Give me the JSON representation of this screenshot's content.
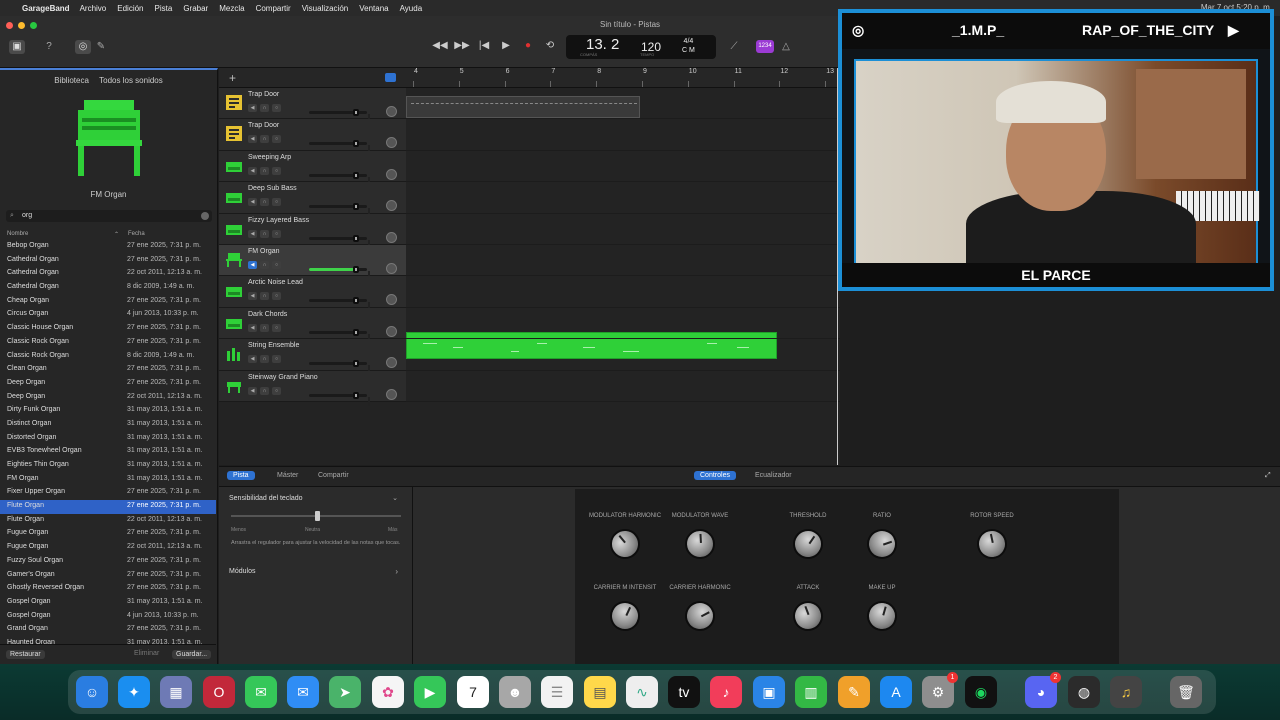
{
  "menubar": {
    "app": "GarageBand",
    "items": [
      "Archivo",
      "Edición",
      "Pista",
      "Grabar",
      "Mezcla",
      "Compartir",
      "Visualización",
      "Ventana",
      "Ayuda"
    ],
    "clock": "Mar 7 oct 5:20 p. m."
  },
  "window": {
    "title": "Sin título - Pistas"
  },
  "lcd": {
    "bar": "13. 2",
    "tempo": "120",
    "sig": "4/4",
    "key": "C M",
    "cap_bar": "COMPÁS",
    "cap_tempo": "TEMPO"
  },
  "count_in": "1234",
  "library": {
    "title": "Biblioteca",
    "filter": "Todos los sonidos",
    "instrument": "FM Organ",
    "search": "org",
    "col_name": "Nombre",
    "col_date": "Fecha",
    "restore": "Restaurar",
    "delete": "Eliminar",
    "save": "Guardar...",
    "rows": [
      {
        "name": "Bebop Organ",
        "date": "27 ene 2025, 7:31 p. m."
      },
      {
        "name": "Cathedral Organ",
        "date": "27 ene 2025, 7:31 p. m."
      },
      {
        "name": "Cathedral Organ",
        "date": "22 oct 2011, 12:13 a. m."
      },
      {
        "name": "Cathedral Organ",
        "date": "8 dic 2009, 1:49 a. m."
      },
      {
        "name": "Cheap Organ",
        "date": "27 ene 2025, 7:31 p. m."
      },
      {
        "name": "Circus Organ",
        "date": "4 jun 2013, 10:33 p. m."
      },
      {
        "name": "Classic House Organ",
        "date": "27 ene 2025, 7:31 p. m."
      },
      {
        "name": "Classic Rock Organ",
        "date": "27 ene 2025, 7:31 p. m."
      },
      {
        "name": "Classic Rock Organ",
        "date": "8 dic 2009, 1:49 a. m."
      },
      {
        "name": "Clean Organ",
        "date": "27 ene 2025, 7:31 p. m."
      },
      {
        "name": "Deep Organ",
        "date": "27 ene 2025, 7:31 p. m."
      },
      {
        "name": "Deep Organ",
        "date": "22 oct 2011, 12:13 a. m."
      },
      {
        "name": "Dirty Funk Organ",
        "date": "31 may 2013, 1:51 a. m."
      },
      {
        "name": "Distinct Organ",
        "date": "31 may 2013, 1:51 a. m."
      },
      {
        "name": "Distorted Organ",
        "date": "31 may 2013, 1:51 a. m."
      },
      {
        "name": "EVB3 Tonewheel Organ",
        "date": "31 may 2013, 1:51 a. m."
      },
      {
        "name": "Eighties Thin Organ",
        "date": "31 may 2013, 1:51 a. m."
      },
      {
        "name": "FM Organ",
        "date": "31 may 2013, 1:51 a. m."
      },
      {
        "name": "Fixer Upper Organ",
        "date": "27 ene 2025, 7:31 p. m."
      },
      {
        "name": "Flute Organ",
        "date": "27 ene 2025, 7:31 p. m."
      },
      {
        "name": "Flute Organ",
        "date": "22 oct 2011, 12:13 a. m."
      },
      {
        "name": "Fugue Organ",
        "date": "27 ene 2025, 7:31 p. m."
      },
      {
        "name": "Fugue Organ",
        "date": "22 oct 2011, 12:13 a. m."
      },
      {
        "name": "Fuzzy Soul Organ",
        "date": "27 ene 2025, 7:31 p. m."
      },
      {
        "name": "Gamer's Organ",
        "date": "27 ene 2025, 7:31 p. m."
      },
      {
        "name": "Ghostly Reversed Organ",
        "date": "27 ene 2025, 7:31 p. m."
      },
      {
        "name": "Gospel Organ",
        "date": "31 may 2013, 1:51 a. m."
      },
      {
        "name": "Gospel Organ",
        "date": "4 jun 2013, 10:33 p. m."
      },
      {
        "name": "Grand Organ",
        "date": "27 ene 2025, 7:31 p. m."
      },
      {
        "name": "Haunted Organ",
        "date": "31 may 2013, 1:51 a. m."
      }
    ],
    "selected_index": 19
  },
  "tracks": [
    {
      "name": "Trap Door",
      "type": "drummer",
      "level": 0.0
    },
    {
      "name": "Trap Door",
      "type": "drummer",
      "level": 0.0
    },
    {
      "name": "Sweeping Arp",
      "type": "synth",
      "level": 0.0
    },
    {
      "name": "Deep Sub Bass",
      "type": "synth",
      "level": 0.0
    },
    {
      "name": "Fizzy Layered Bass",
      "type": "synth",
      "level": 0.0
    },
    {
      "name": "FM Organ",
      "type": "organ",
      "level": 0.8
    },
    {
      "name": "Arctic Noise Lead",
      "type": "synth",
      "level": 0.0
    },
    {
      "name": "Dark Chords",
      "type": "synth",
      "level": 0.0
    },
    {
      "name": "String Ensemble",
      "type": "strings",
      "level": 0.0
    },
    {
      "name": "Steinway Grand Piano",
      "type": "piano",
      "level": 0.0
    }
  ],
  "selected_track": 5,
  "ruler": [
    "4",
    "5",
    "6",
    "7",
    "8",
    "9",
    "10",
    "11",
    "12",
    "13"
  ],
  "smart": {
    "tabs_left": [
      "Pista",
      "Máster",
      "Compartir"
    ],
    "tabs_right": [
      "Controles",
      "Ecualizador"
    ],
    "sensitivity": "Sensibilidad del teclado",
    "less": "Menos",
    "neutral": "Neutra",
    "more": "Más",
    "hint": "Arrastra el regulador para ajustar la velocidad de las notas que tocas.",
    "modules": "Módulos",
    "knobs": [
      "MODULATOR HARMONIC",
      "MODULATOR WAVE",
      "THRESHOLD",
      "RATIO",
      "ROTOR SPEED",
      "CARRIER M INTENSIT",
      "CARRIER HARMONIC",
      "ATTACK",
      "MAKE UP"
    ]
  },
  "video": {
    "handle": "_1.M.P_",
    "channel": "RAP_OF_THE_CITY",
    "name": "EL PARCE"
  },
  "colors": {
    "accent": "#2e72d2",
    "region": "#2fd038",
    "overlay": "#1c8fd6"
  }
}
